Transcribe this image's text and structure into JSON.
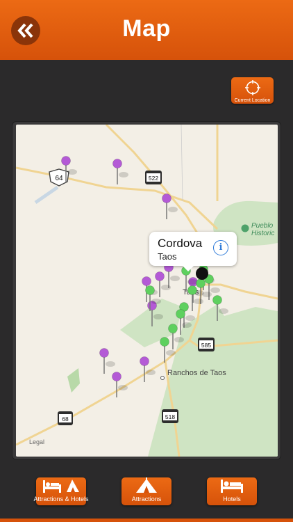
{
  "header": {
    "title": "Map",
    "back_icon": "double-chevron-left-icon"
  },
  "current_location_button": {
    "label": "Current Location",
    "icon": "crosshair-icon"
  },
  "map": {
    "legal": "Legal",
    "place_labels": {
      "taos": "Taos",
      "ranchos": "Ranchos de Taos",
      "pueblo_line1": "Pueblo",
      "pueblo_line2": "Historic"
    },
    "route_shields": {
      "us64": "64",
      "r522": "522",
      "r585": "585",
      "r68": "68",
      "r518": "518"
    },
    "callout": {
      "title": "Cordova",
      "subtitle": "Taos"
    }
  },
  "tabs": [
    {
      "label": "Attractions & Hotels",
      "icon": "bed-and-tent-icon"
    },
    {
      "label": "Attractions",
      "icon": "tent-icon"
    },
    {
      "label": "Hotels",
      "icon": "bed-icon"
    }
  ],
  "colors": {
    "accent": "#e0600f",
    "attraction_pin": "#b45ad6",
    "hotel_pin": "#5ed05e"
  }
}
